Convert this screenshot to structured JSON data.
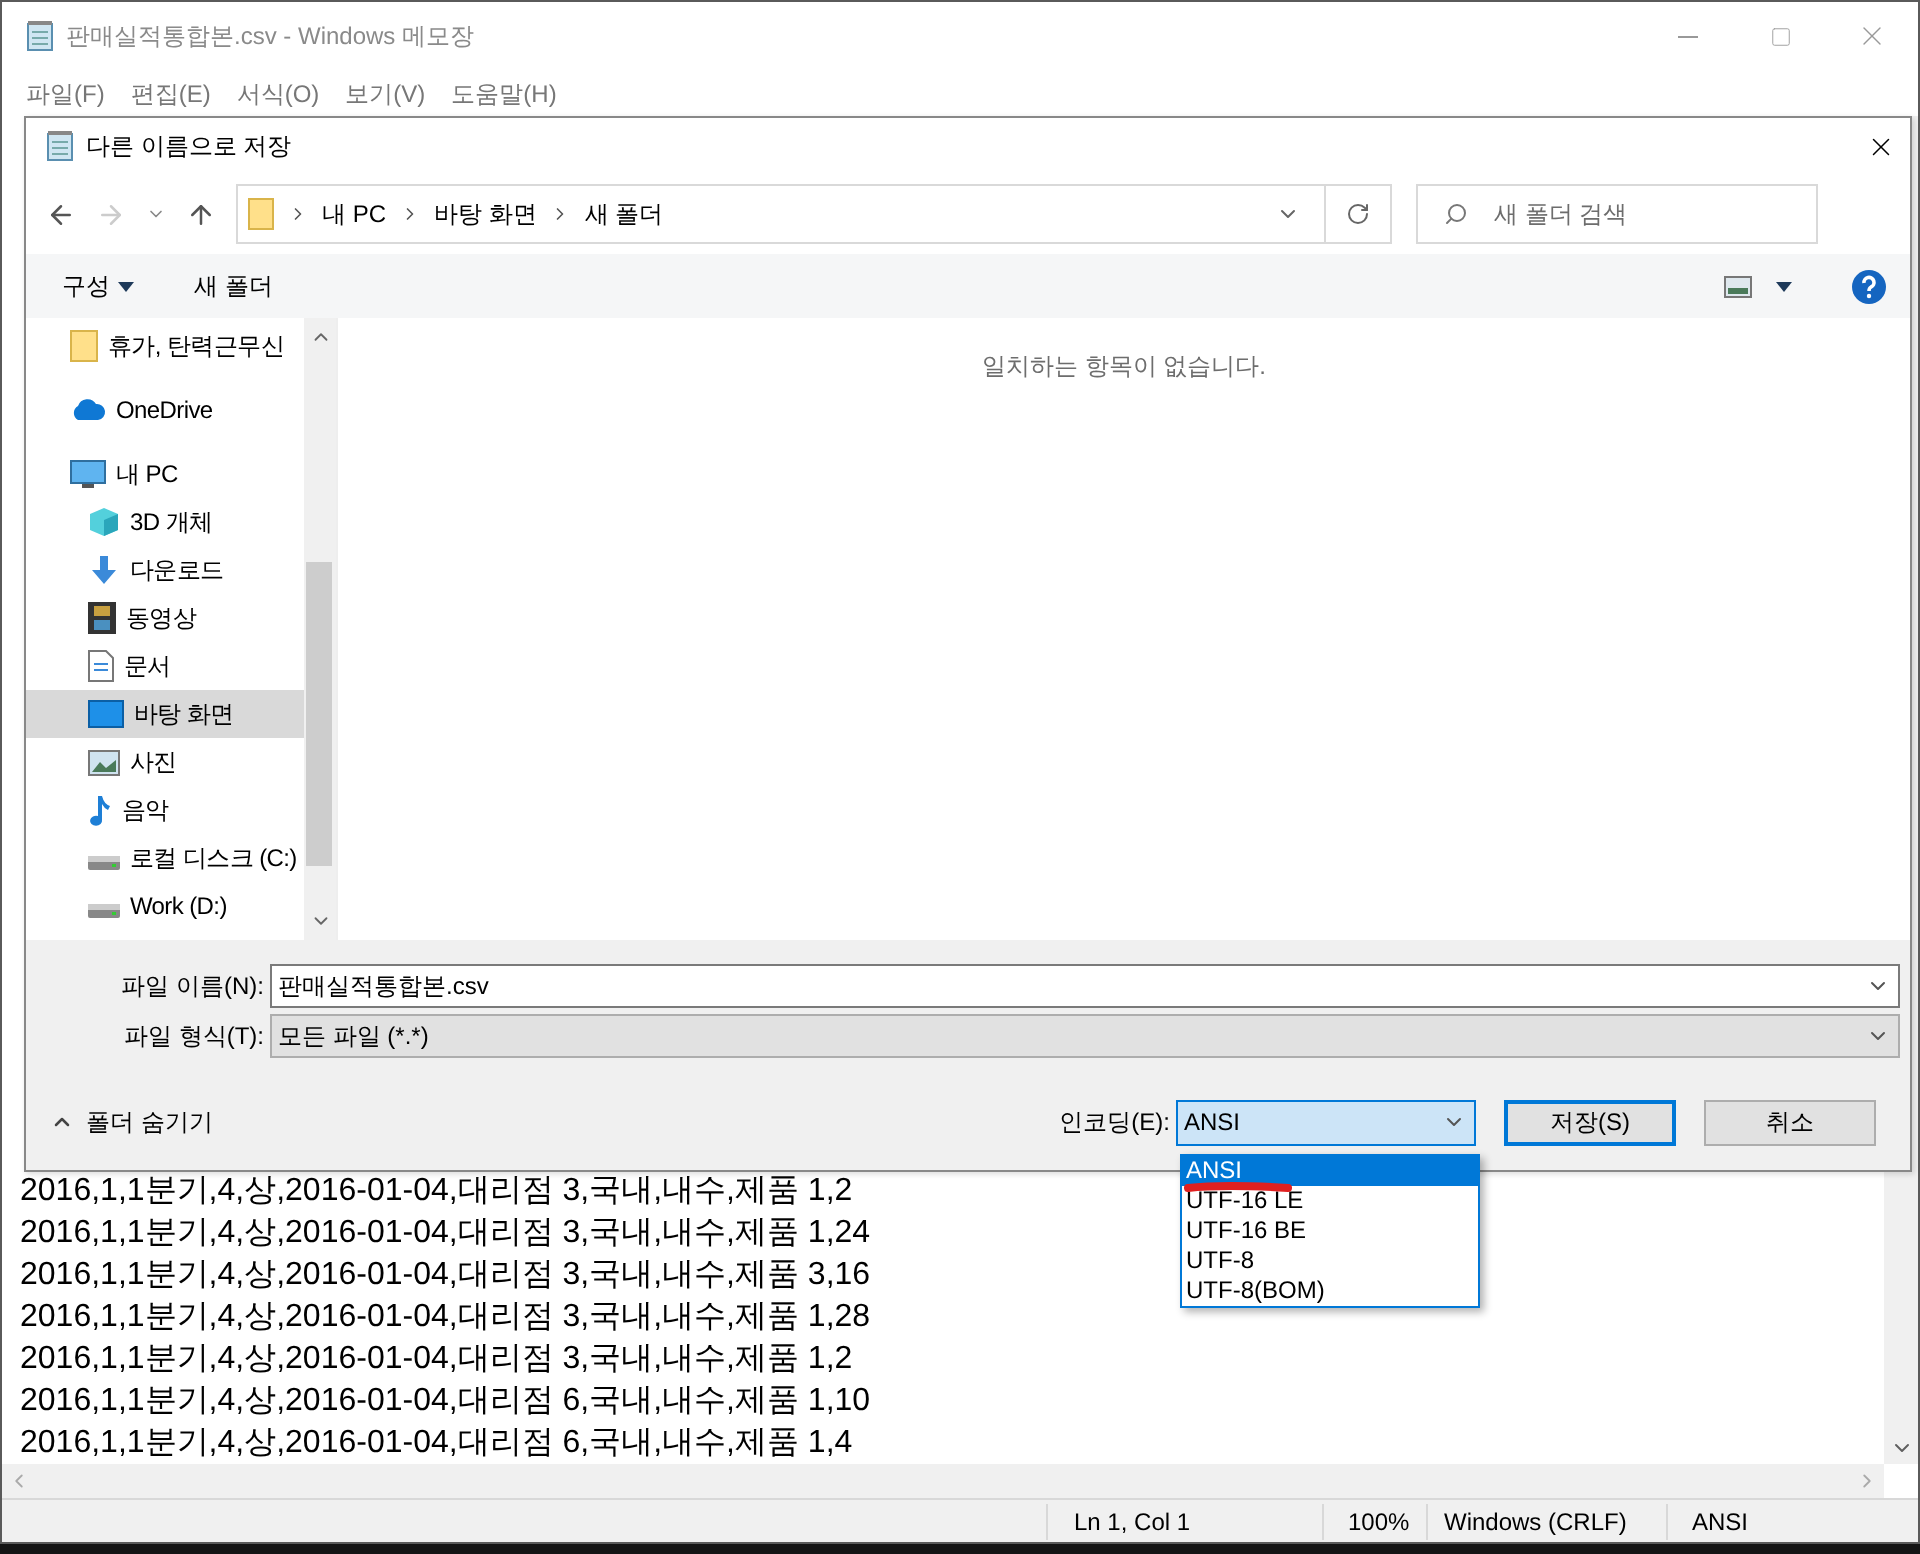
{
  "notepad": {
    "title": "판매실적통합본.csv - Windows 메모장",
    "menu": [
      "파일(F)",
      "편집(E)",
      "서식(O)",
      "보기(V)",
      "도움말(H)"
    ],
    "lines": [
      "2016,1,1분기,4,상,2016-01-04,대리점 3,국내,내수,제품 1,2",
      "2016,1,1분기,4,상,2016-01-04,대리점 3,국내,내수,제품 1,24",
      "2016,1,1분기,4,상,2016-01-04,대리점 3,국내,내수,제품 3,16",
      "2016,1,1분기,4,상,2016-01-04,대리점 3,국내,내수,제품 1,28",
      "2016,1,1분기,4,상,2016-01-04,대리점 3,국내,내수,제품 1,2",
      "2016,1,1분기,4,상,2016-01-04,대리점 6,국내,내수,제품 1,10",
      "2016,1,1분기,4,상,2016-01-04,대리점 6,국내,내수,제품 1,4"
    ],
    "status_bar": [
      "Ln 1, Col 1",
      "100%",
      "Windows (CRLF)",
      "ANSI"
    ]
  },
  "dialog": {
    "title": "다른 이름으로 저장",
    "breadcrumb": [
      "내 PC",
      "바탕 화면",
      "새 폴더"
    ],
    "search": {
      "placeholder": "새 폴더 검색"
    },
    "toolbar": [
      "구성",
      "새 폴더"
    ],
    "sidebar": [
      {
        "children": [
          {
            "label": "휴가, 탄력근무신",
            "kind": "folder",
            "selected": false
          }
        ]
      },
      {
        "label": "OneDrive",
        "kind": "cloud",
        "selected": false
      },
      {
        "label": "내 PC",
        "kind": "pc",
        "selected": false,
        "children": [
          {
            "label": "3D 개체",
            "kind": "cube",
            "selected": false
          },
          {
            "label": "다운로드",
            "kind": "download",
            "selected": false
          },
          {
            "label": "동영상",
            "kind": "film",
            "selected": false
          },
          {
            "label": "문서",
            "kind": "document",
            "selected": false
          },
          {
            "label": "바탕 화면",
            "kind": "desktop",
            "selected": true
          },
          {
            "label": "사진",
            "kind": "photo",
            "selected": false
          },
          {
            "label": "음악",
            "kind": "music",
            "selected": false
          },
          {
            "label": "로컬 디스크 (C:)",
            "kind": "drive",
            "selected": false
          },
          {
            "label": "Work (D:)",
            "kind": "drive",
            "selected": false
          }
        ]
      }
    ],
    "empty_message": "일치하는 항목이 없습니다.",
    "file_name": {
      "label": "파일 이름(N):",
      "value": "판매실적통합본.csv"
    },
    "file_type": {
      "label": "파일 형식(T):",
      "value": "모든 파일 (*.*)"
    },
    "hide_folders": "폴더 숨기기",
    "encoding": {
      "label": "인코딩(E):",
      "value": "ANSI",
      "options": [
        {
          "label": "ANSI",
          "selected": true
        },
        {
          "label": "UTF-16 LE",
          "selected": false
        },
        {
          "label": "UTF-16 BE",
          "selected": false
        },
        {
          "label": "UTF-8",
          "selected": false
        },
        {
          "label": "UTF-8(BOM)",
          "selected": false
        }
      ]
    },
    "buttons": [
      {
        "label": "저장(S)",
        "default": true
      },
      {
        "label": "취소",
        "default": false
      }
    ]
  }
}
